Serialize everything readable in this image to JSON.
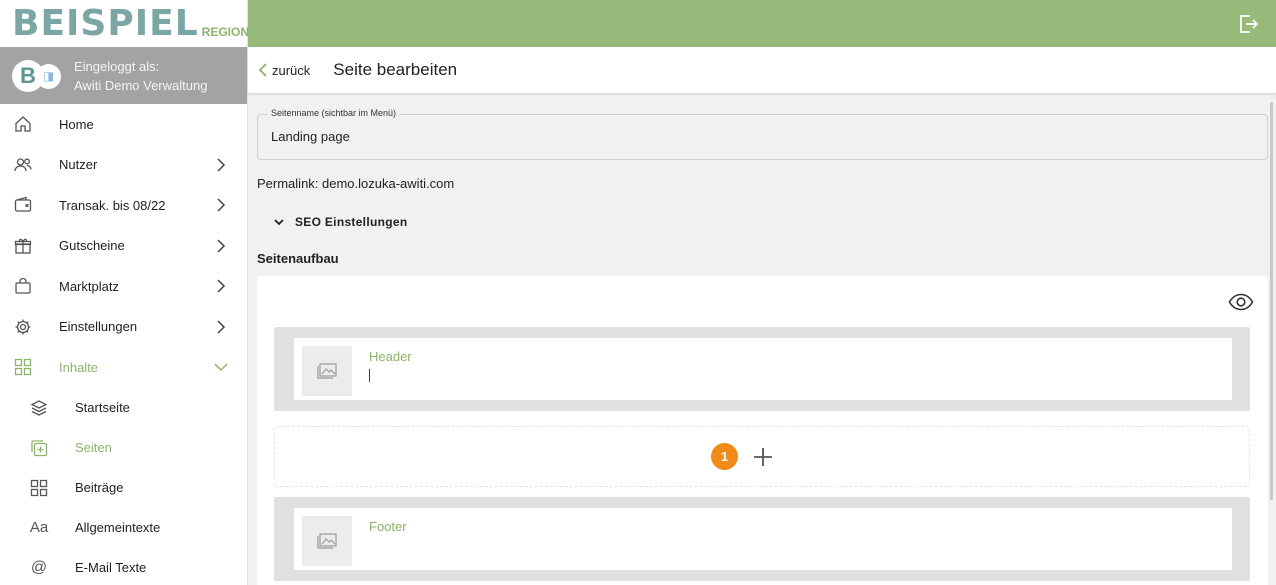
{
  "brand": {
    "logo_main": "BEISPIEL",
    "logo_region": "REGION",
    "accent": "#8db36a",
    "topbar": "#95ba7a"
  },
  "user": {
    "label": "Eingeloggt als:",
    "name": "Awiti Demo Verwaltung"
  },
  "nav": [
    {
      "label": "Home",
      "icon": "home-icon"
    },
    {
      "label": "Nutzer",
      "icon": "users-icon"
    },
    {
      "label": "Transak. bis 08/22",
      "icon": "wallet-icon"
    },
    {
      "label": "Gutscheine",
      "icon": "gift-icon"
    },
    {
      "label": "Marktplatz",
      "icon": "shopping-bag-icon"
    },
    {
      "label": "Einstellungen",
      "icon": "gear-icon"
    },
    {
      "label": "Inhalte",
      "icon": "grid-icon"
    }
  ],
  "subnav": [
    {
      "label": "Startseite",
      "icon": "layers-icon"
    },
    {
      "label": "Seiten",
      "icon": "add-page-icon"
    },
    {
      "label": "Beiträge",
      "icon": "grid-icon"
    },
    {
      "label": "Allgemeintexte",
      "icon": "text-icon"
    },
    {
      "label": "E-Mail Texte",
      "icon": "at-icon"
    }
  ],
  "header": {
    "back_label": "zurück",
    "title": "Seite bearbeiten"
  },
  "form": {
    "page_name_label": "Seitenname (sichtbar im Menü)",
    "page_name_value": "Landing page",
    "permalink": "Permalink: demo.lozuka-awiti.com",
    "seo_label": "SEO Einstellungen",
    "section_title": "Seitenaufbau"
  },
  "blocks": {
    "header_title": "Header",
    "footer_title": "Footer",
    "add_badge": "1"
  }
}
